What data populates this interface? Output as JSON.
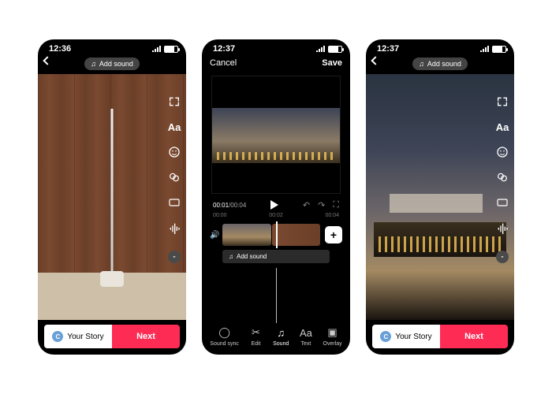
{
  "status": {
    "time_a": "12:36",
    "time_b": "12:37",
    "time_c": "12:37",
    "battery": "66"
  },
  "add_sound": "Add sound",
  "note_glyph": "♫",
  "bottom": {
    "story": "Your Story",
    "story_initial": "C",
    "next": "Next"
  },
  "rail": {
    "text_label": "Aa"
  },
  "editor": {
    "cancel": "Cancel",
    "save": "Save",
    "cur": "00:01",
    "total": "/00:04",
    "ticks": [
      "00:00",
      "00:02",
      "00:04"
    ],
    "add_sound": "Add sound",
    "tools": {
      "soundsync": "Sound sync",
      "edit": "Edit",
      "sound": "Sound",
      "text": "Text",
      "overlay": "Overlay"
    },
    "text_glyph": "Aa",
    "plus": "+"
  }
}
